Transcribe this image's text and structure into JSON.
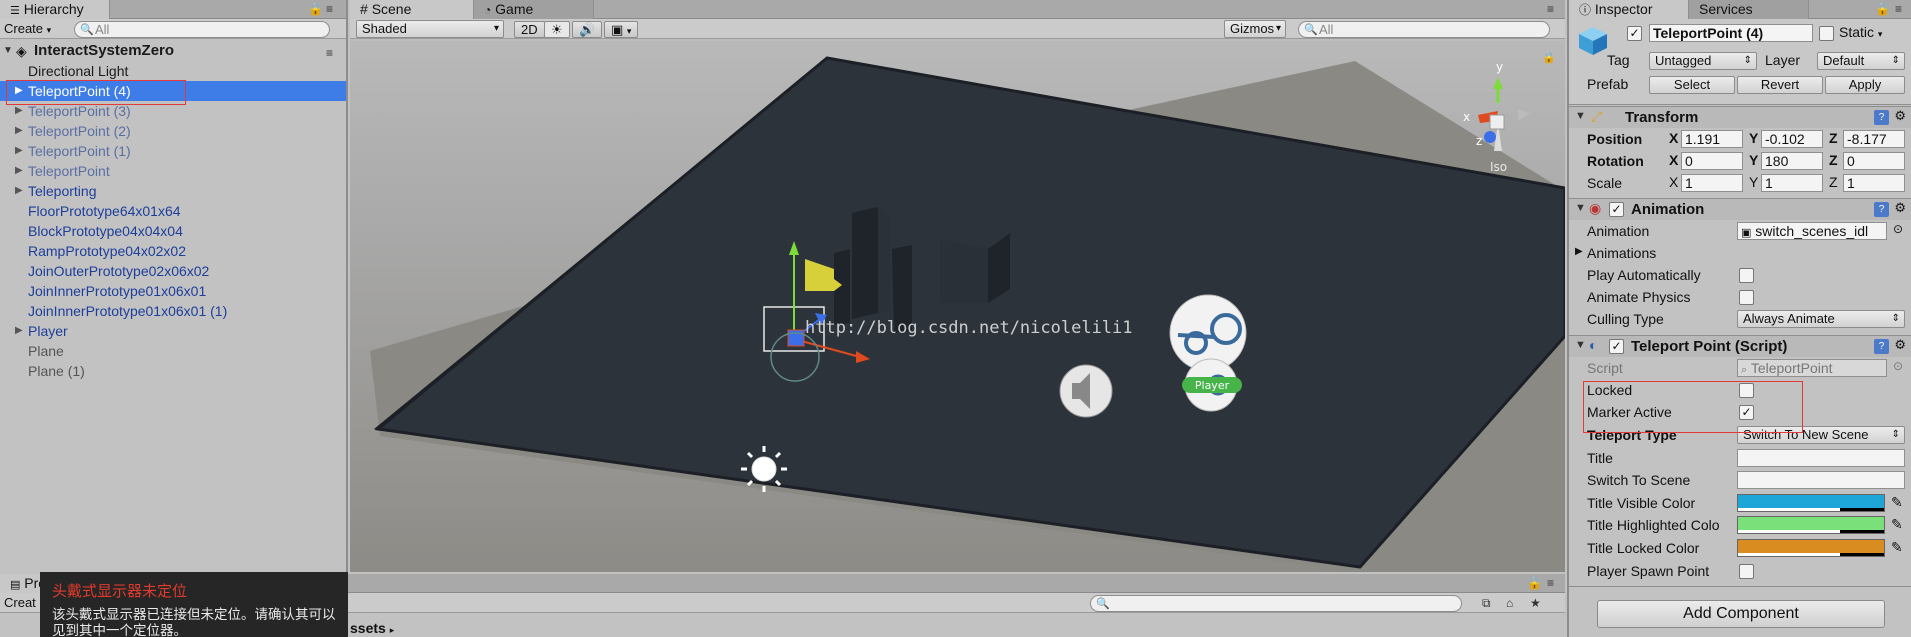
{
  "hierarchy": {
    "tab": "Hierarchy",
    "create": "Create",
    "search_placeholder": "All",
    "root": "InteractSystemZero",
    "items": [
      {
        "label": "Directional Light"
      },
      {
        "label": "TeleportPoint (4)"
      },
      {
        "label": "TeleportPoint (3)"
      },
      {
        "label": "TeleportPoint (2)"
      },
      {
        "label": "TeleportPoint (1)"
      },
      {
        "label": "TeleportPoint"
      },
      {
        "label": "Teleporting"
      },
      {
        "label": "FloorPrototype64x01x64"
      },
      {
        "label": "BlockPrototype04x04x04"
      },
      {
        "label": "RampPrototype04x02x02"
      },
      {
        "label": "JoinOuterPrototype02x06x02"
      },
      {
        "label": "JoinInnerPrototype01x06x01"
      },
      {
        "label": "JoinInnerPrototype01x06x01 (1)"
      },
      {
        "label": "Player"
      },
      {
        "label": "Plane"
      },
      {
        "label": "Plane (1)"
      }
    ]
  },
  "scene": {
    "tabs": [
      "Scene",
      "Game"
    ],
    "shading": "Shaded",
    "mode_2d": "2D",
    "gizmos": "Gizmos",
    "search_placeholder": "All",
    "watermark": "http://blog.csdn.net/nicolelili1",
    "gizmo_iso": "Iso",
    "player_label": "Player",
    "axis_y": "y",
    "axis_x": "x",
    "axis_z": "z"
  },
  "inspector": {
    "tabs": [
      "Inspector",
      "Services"
    ],
    "object_name": "TeleportPoint (4)",
    "static_label": "Static",
    "tag_label": "Tag",
    "tag_value": "Untagged",
    "layer_label": "Layer",
    "layer_value": "Default",
    "prefab_label": "Prefab",
    "prefab_select": "Select",
    "prefab_revert": "Revert",
    "prefab_apply": "Apply",
    "transform": {
      "title": "Transform",
      "position_label": "Position",
      "position": [
        "1.191",
        "-0.102",
        "-8.177"
      ],
      "rotation_label": "Rotation",
      "rotation": [
        "0",
        "180",
        "0"
      ],
      "scale_label": "Scale",
      "scale": [
        "1",
        "1",
        "1"
      ],
      "x": "X",
      "y": "Y",
      "z": "Z"
    },
    "animation": {
      "title": "Animation",
      "animation_label": "Animation",
      "animation_value": "switch_scenes_idl",
      "animations_label": "Animations",
      "play_auto_label": "Play Automatically",
      "animate_physics_label": "Animate Physics",
      "culling_label": "Culling Type",
      "culling_value": "Always Animate"
    },
    "teleport": {
      "title": "Teleport Point (Script)",
      "script_label": "Script",
      "script_value": "TeleportPoint",
      "locked_label": "Locked",
      "marker_active_label": "Marker Active",
      "teleport_type_label": "Teleport Type",
      "teleport_type_value": "Switch To New Scene",
      "title_label": "Title",
      "switch_scene_label": "Switch To Scene",
      "title_visible_label": "Title Visible Color",
      "title_highlighted_label": "Title Highlighted Colo",
      "title_locked_label": "Title Locked Color",
      "player_spawn_label": "Player Spawn Point",
      "colors": {
        "visible": "#1fa6d9",
        "highlighted": "#7ae07a",
        "locked": "#d98c1f"
      }
    },
    "add_component": "Add Component"
  },
  "project": {
    "tab": "Pro",
    "create": "Creat",
    "path": "ssets"
  },
  "toast": {
    "title": "头戴式显示器未定位",
    "body": "该头戴式显示器已连接但未定位。请确认其可以见到其中一个定位器。"
  },
  "colors": {
    "selection": "#3e7de7",
    "floor": "#2d333b",
    "highlight_box": "#e23a3a"
  }
}
